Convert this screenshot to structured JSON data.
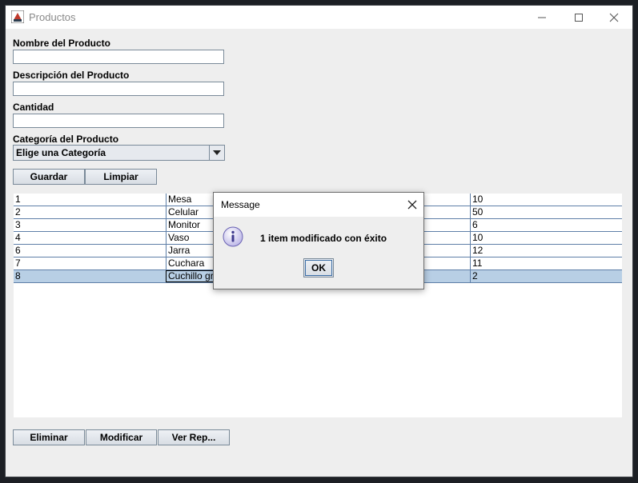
{
  "window": {
    "title": "Productos"
  },
  "form": {
    "nombre_label": "Nombre del Producto",
    "nombre_value": "",
    "descripcion_label": "Descripción del Producto",
    "descripcion_value": "",
    "cantidad_label": "Cantidad",
    "cantidad_value": "",
    "categoria_label": "Categoría del Producto",
    "categoria_selected": "Elige una Categoría"
  },
  "buttons": {
    "guardar": "Guardar",
    "limpiar": "Limpiar",
    "eliminar": "Eliminar",
    "modificar": "Modificar",
    "ver_reporte": "Ver Rep..."
  },
  "table": {
    "rows": [
      {
        "id": "1",
        "name": "Mesa",
        "desc": "",
        "qty": "10"
      },
      {
        "id": "2",
        "name": "Celular",
        "desc": "",
        "qty": "50"
      },
      {
        "id": "3",
        "name": "Monitor",
        "desc": "",
        "qty": "6"
      },
      {
        "id": "4",
        "name": "Vaso",
        "desc": "",
        "qty": "10"
      },
      {
        "id": "6",
        "name": "Jarra",
        "desc": "",
        "qty": "12"
      },
      {
        "id": "7",
        "name": "Cuchara",
        "desc": "",
        "qty": "11"
      },
      {
        "id": "8",
        "name": "Cuchillo gr",
        "desc": "",
        "qty": "2"
      }
    ],
    "selected_row_index": 6
  },
  "dialog": {
    "title": "Message",
    "message": "1 item modificado con éxito",
    "ok_label": "OK",
    "icon": "info-icon"
  },
  "colors": {
    "accent": "#3c6ea6",
    "selection": "#b8cfe5",
    "grid": "#5f7fa8"
  }
}
